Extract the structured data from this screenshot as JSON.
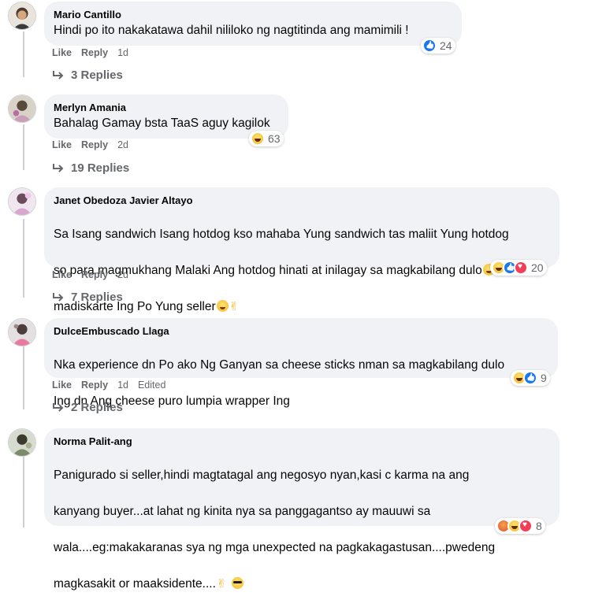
{
  "comments": [
    {
      "author": "Mario Cantillo",
      "text": "Hindi po ito nakakatawa dahil nililoko ng nagtitinda ang mamimili !",
      "reactions": [
        "like"
      ],
      "reaction_count": "24",
      "like_label": "Like",
      "reply_label": "Reply",
      "time": "1d",
      "replies_label": "3 Replies"
    },
    {
      "author": "Merlyn Amania",
      "text": "Bahalag Gamay bsta TaaS aguy kagilok",
      "reactions": [
        "haha"
      ],
      "reaction_count": "63",
      "like_label": "Like",
      "reply_label": "Reply",
      "time": "2d",
      "replies_label": "19 Replies"
    },
    {
      "author": "Janet Obedoza Javier Altayo",
      "text_line1": "Sa Isang sandwich Isang hotdog kso mahaba Yung sandwich tas maliit Yung hotdog",
      "text_line2": "so para magmukhang Malaki Ang hotdog hinati at inilagay sa magkabilang dulo",
      "text_line3": "madiskarte Ing Po Yung seller",
      "reactions": [
        "haha",
        "like",
        "love"
      ],
      "reaction_count": "20",
      "like_label": "Like",
      "reply_label": "Reply",
      "time": "2d",
      "replies_label": "7 Replies"
    },
    {
      "author": "DulceEmbuscado Llaga",
      "text_line1": "Nka experience dn Po ako Ng Ganyan sa cheese sticks nman sa magkabilang dulo",
      "text_line2": "Ing dn Ang cheese puro lumpia wrapper Ing",
      "reactions": [
        "haha",
        "like"
      ],
      "reaction_count": "9",
      "like_label": "Like",
      "reply_label": "Reply",
      "time": "1d",
      "edited_label": "Edited",
      "replies_label": "2 Replies"
    },
    {
      "author": "Norma Palit-ang",
      "text_line1": "Panigurado si seller,hindi magtatagal ang negosyo nyan,kasi c karma na ang",
      "text_line2": "kanyang buyer...at lahat ng kinita nya sa panggagantso ay mauuwi sa",
      "text_line3": "wala....eg:makakaranas sya ng mga unexpected na pagkakagastusan....pwedeng",
      "text_line4": "magkasakit or maaksidente....",
      "reactions": [
        "angry",
        "haha",
        "love"
      ],
      "reaction_count": "8"
    }
  ],
  "colors": {
    "bubble": "#f0f2f5",
    "meta": "#65676b",
    "like_blue": "#1877f2",
    "love_red": "#f33e58",
    "thread_line": "#ced0d4"
  }
}
